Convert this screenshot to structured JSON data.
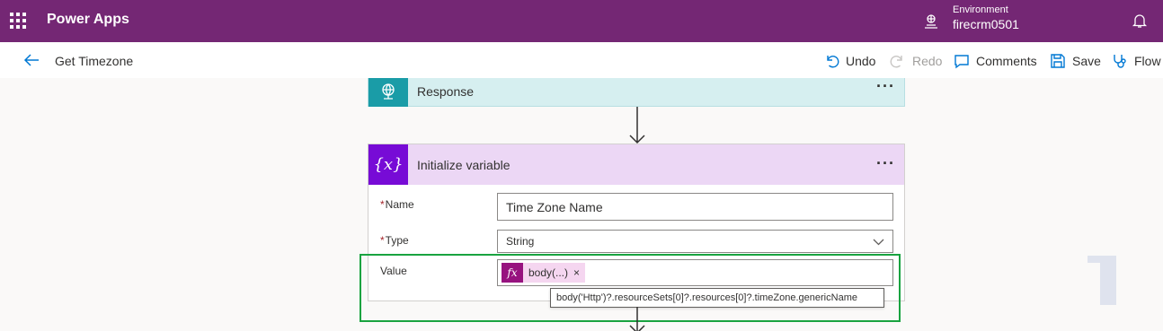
{
  "appbar": {
    "app_name": "Power Apps",
    "environment_label": "Environment",
    "environment_name": "firecrm0501",
    "color": "#742774"
  },
  "cmdbar": {
    "flow_title": "Get Timezone",
    "undo": "Undo",
    "redo": "Redo",
    "comments": "Comments",
    "save": "Save",
    "flow_checker": "Flow c"
  },
  "response_card": {
    "title": "Response",
    "icon": "globe-icon",
    "color": "#1a9ca7"
  },
  "variable_card": {
    "title": "Initialize variable",
    "icon_text": "{x}",
    "color": "#770bd6",
    "name_label": "Name",
    "name_value": "Time Zone Name",
    "type_label": "Type",
    "type_value": "String",
    "value_label": "Value",
    "token_fx": "fx",
    "token_text": "body(...)",
    "token_remove": "×",
    "tooltip": "body('Http')?.resourceSets[0]?.resources[0]?.timeZone.genericName"
  },
  "more_dots": "···"
}
